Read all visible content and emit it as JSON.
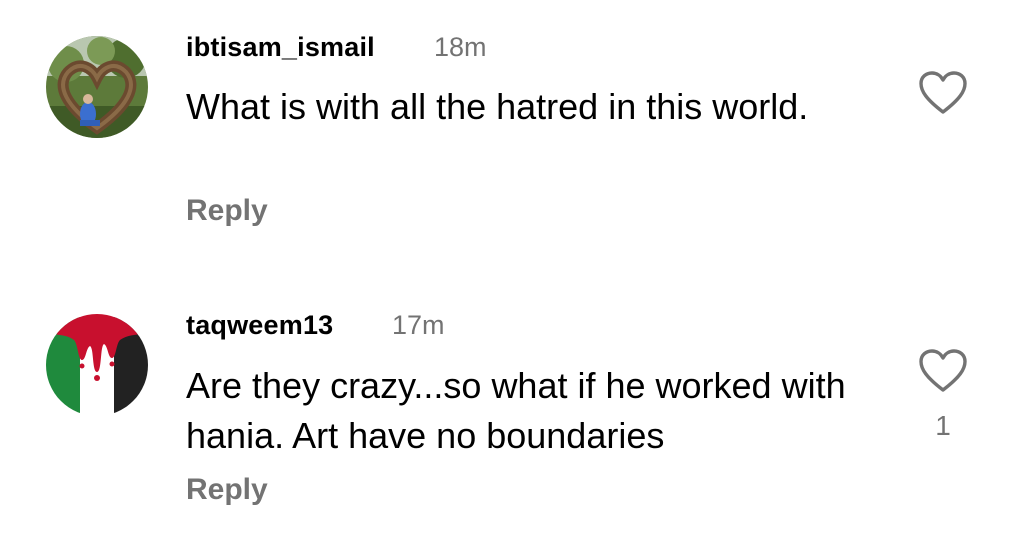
{
  "comments": [
    {
      "username": "ibtisam_ismail",
      "time": "18m",
      "text": "What is with all the hatred in this world.",
      "reply_label": "Reply",
      "like_icon": "heart-outline-icon",
      "like_count": ""
    },
    {
      "username": "taqweem13",
      "time": "17m",
      "text": "Are they crazy...so what if he worked with hania. Art have no boundaries",
      "reply_label": "Reply",
      "like_icon": "heart-outline-icon",
      "like_count": "1"
    }
  ],
  "colors": {
    "text": "#000000",
    "secondary": "#737373",
    "background": "#ffffff"
  }
}
